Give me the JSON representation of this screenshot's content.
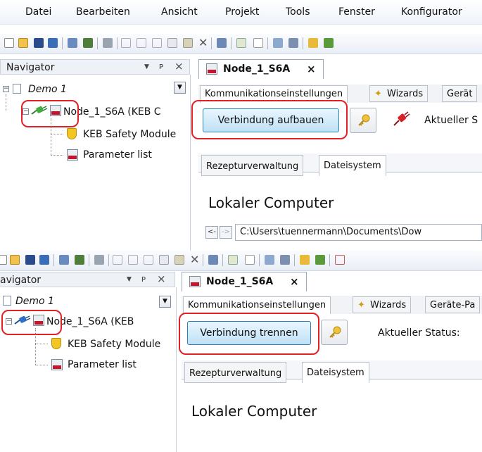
{
  "menu": {
    "items": [
      "Datei",
      "Bearbeiten",
      "Ansicht",
      "Projekt",
      "Tools",
      "Fenster",
      "Konfigurator"
    ]
  },
  "navigator": {
    "title": "Navigator",
    "title_clipped": "avigator",
    "pin_icon": "pin-icon",
    "close_glyph": "×",
    "dropdown_glyph": "▼",
    "pin_glyph": "ᴘ",
    "tree": {
      "root": "Demo 1",
      "node": "Node_1_S6A (KEB C",
      "node_clipped": "Node_1_S6A (KEB",
      "children": [
        "KEB Safety Module",
        "Parameter list"
      ]
    },
    "expander_minus": "−"
  },
  "document": {
    "tab_label": "Node_1_S6A",
    "tab_close": "×",
    "top_tabs": [
      "Kommunikationseinstellungen",
      "Wizards",
      "Gerät",
      "Geräte-Pa"
    ],
    "sub_tabs": [
      "Rezepturverwaltung",
      "Dateisystem"
    ],
    "section_title": "Lokaler Computer",
    "path": "C:\\Users\\tuennermann\\Documents\\Dow",
    "nav_back": "<-",
    "nav_fwd": "->"
  },
  "panel1": {
    "connect_button": "Verbindung aufbauen",
    "status_label": "Aktueller S"
  },
  "panel2": {
    "connect_button": "Verbindung trennen",
    "status_label": "Aktueller Status:"
  },
  "colors": {
    "annotation": "#e22026",
    "button_border": "#2f7fb3",
    "keb_red": "#c8142a",
    "plug_green": "#3fae3f",
    "plug_red": "#d8202b"
  }
}
